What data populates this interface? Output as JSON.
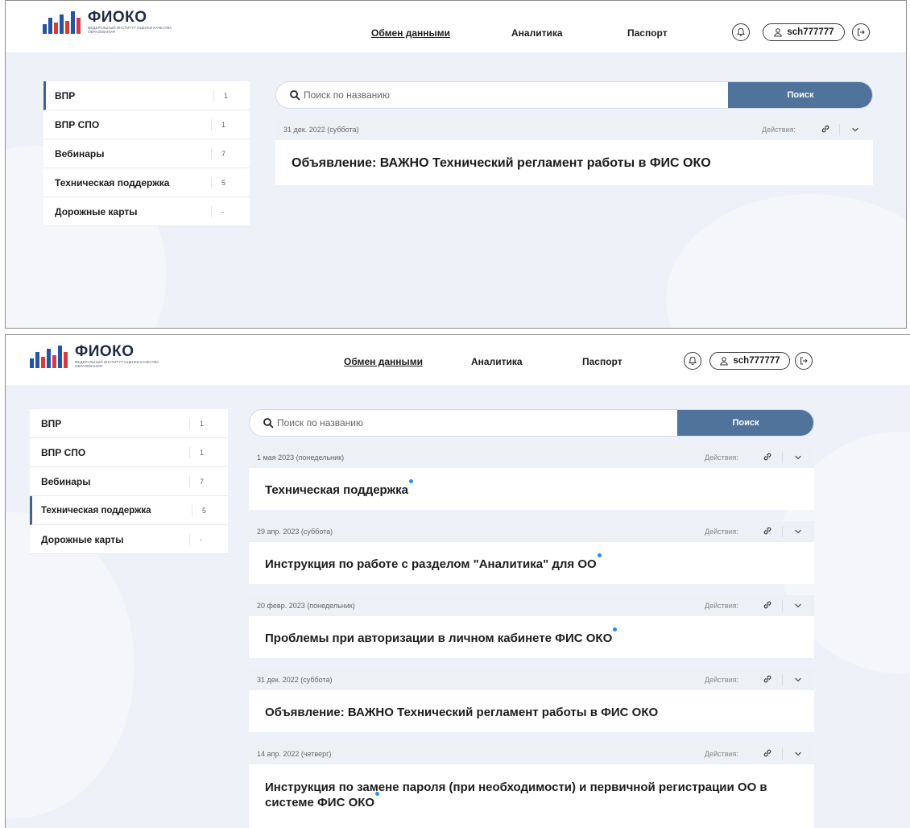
{
  "colors": {
    "accent": "#50739c",
    "new_dot": "#2b8fe0",
    "active_border": "#41628a"
  },
  "logo": {
    "title": "ФИОКО",
    "subtitle": "Федеральный институт оценки качества образования"
  },
  "nav": {
    "exchange": "Обмен данными",
    "analytics": "Аналитика",
    "passport": "Паспорт"
  },
  "icons": {
    "bell": "bell-icon",
    "user": "user-icon",
    "logout": "logout-icon",
    "search": "search-icon",
    "link": "link-icon",
    "chevron": "chevron-down-icon"
  },
  "user": {
    "login": "sch777777"
  },
  "sidebar": {
    "items": [
      {
        "label": "ВПР",
        "count": "1"
      },
      {
        "label": "ВПР СПО",
        "count": "1"
      },
      {
        "label": "Вебинары",
        "count": "7"
      },
      {
        "label": "Техническая поддержка",
        "count": "5"
      },
      {
        "label": "Дорожные карты",
        "count": "-"
      }
    ]
  },
  "search": {
    "placeholder": "Поиск по названию",
    "button": "Поиск"
  },
  "actions_label": "Действия:",
  "screen1": {
    "active_sidebar": "ВПР",
    "cards": [
      {
        "date": "31 дек. 2022 (суббота)",
        "title": "Объявление: ВАЖНО Технический регламент работы в ФИС ОКО",
        "new": false
      }
    ]
  },
  "screen2": {
    "active_sidebar": "Техническая поддержка",
    "cards": [
      {
        "date": "1 мая 2023 (понедельник)",
        "title": "Техническая поддержка",
        "new": true
      },
      {
        "date": "29 апр. 2023 (суббота)",
        "title": "Инструкция по работе с разделом \"Аналитика\" для ОО",
        "new": true
      },
      {
        "date": "20 февр. 2023 (понедельник)",
        "title": "Проблемы при авторизации в личном кабинете ФИС ОКО",
        "new": true
      },
      {
        "date": "31 дек. 2022 (суббота)",
        "title": "Объявление: ВАЖНО Технический регламент работы в ФИС ОКО",
        "new": false
      },
      {
        "date": "14 апр. 2022 (четверг)",
        "title": "Инструкция по замене пароля (при необходимости) и первичной регистрации ОО в системе ФИС ОКО",
        "new": true
      }
    ]
  }
}
